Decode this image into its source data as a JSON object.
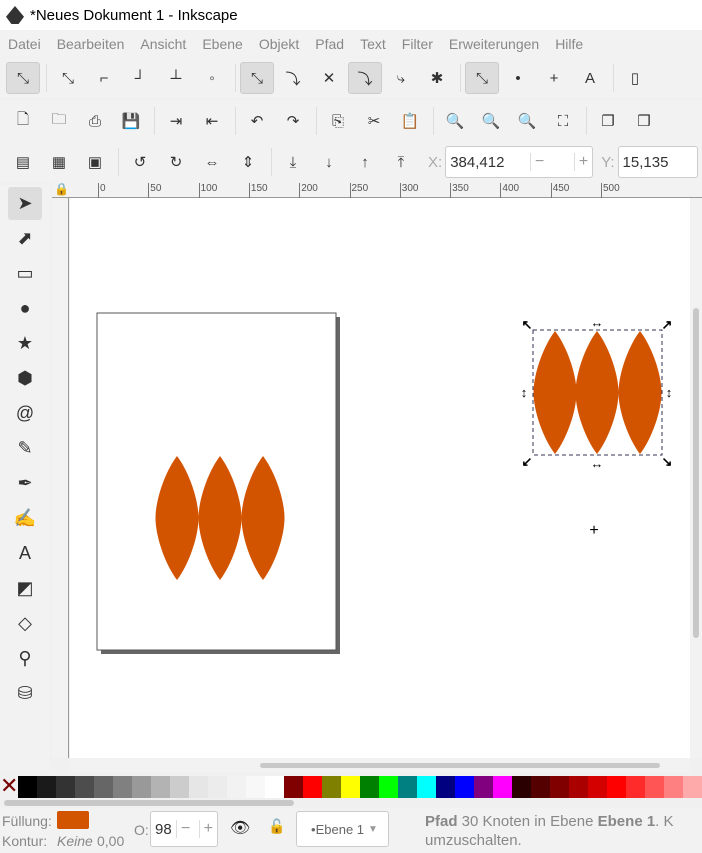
{
  "window": {
    "title": "*Neues Dokument 1 - Inkscape"
  },
  "menu": [
    "Datei",
    "Bearbeiten",
    "Ansicht",
    "Ebene",
    "Objekt",
    "Pfad",
    "Text",
    "Filter",
    "Erweiterungen",
    "Hilfe"
  ],
  "toolbar_snap": [
    {
      "icon": "snap-enable-icon",
      "g": "⤡",
      "on": true
    },
    {
      "icon": "snap-bbox-icon",
      "g": "⤡"
    },
    {
      "icon": "snap-bbox-edge-icon",
      "g": "⌐"
    },
    {
      "icon": "snap-bbox-corner-icon",
      "g": "┘"
    },
    {
      "icon": "snap-bbox-midpoint-icon",
      "g": "┴"
    },
    {
      "icon": "snap-bbox-center-icon",
      "g": "◦"
    },
    {
      "icon": "snap-nodes-icon",
      "g": "⤡",
      "on": true
    },
    {
      "icon": "snap-path-icon",
      "g": "⤵"
    },
    {
      "icon": "snap-intersection-icon",
      "g": "✕"
    },
    {
      "icon": "snap-cusp-icon",
      "g": "⤵",
      "on": true
    },
    {
      "icon": "snap-smooth-icon",
      "g": "⤷"
    },
    {
      "icon": "snap-midpoint-icon",
      "g": "✱"
    },
    {
      "icon": "snap-others-icon",
      "g": "⤡",
      "on": true
    },
    {
      "icon": "snap-center-icon",
      "g": "•"
    },
    {
      "icon": "snap-rotation-center-icon",
      "g": "+"
    },
    {
      "icon": "snap-text-baseline-icon",
      "g": "A"
    },
    {
      "icon": "snap-page-icon",
      "g": "▯"
    }
  ],
  "toolbar_commands": [
    {
      "icon": "new-document-icon",
      "g": "🗋"
    },
    {
      "icon": "open-icon",
      "g": "🗀"
    },
    {
      "icon": "print-icon",
      "g": "⎙"
    },
    {
      "icon": "save-icon",
      "g": "💾"
    },
    {
      "icon": "import-icon",
      "g": "⇥"
    },
    {
      "icon": "export-icon",
      "g": "⇤"
    },
    {
      "icon": "undo-icon",
      "g": "↶"
    },
    {
      "icon": "redo-icon",
      "g": "↷"
    },
    {
      "icon": "copy-icon",
      "g": "⎘"
    },
    {
      "icon": "cut-icon",
      "g": "✂"
    },
    {
      "icon": "paste-icon",
      "g": "📋"
    },
    {
      "icon": "zoom-selection-icon",
      "g": "🔍"
    },
    {
      "icon": "zoom-drawing-icon",
      "g": "🔍"
    },
    {
      "icon": "zoom-page-icon",
      "g": "🔍"
    },
    {
      "icon": "zoom-fit-width-icon",
      "g": "⛶"
    },
    {
      "icon": "duplicate-icon",
      "g": "❐"
    },
    {
      "icon": "clone-icon",
      "g": "❒"
    }
  ],
  "toolbar_select": [
    {
      "icon": "select-all-icon",
      "g": "▤"
    },
    {
      "icon": "select-all-layers-icon",
      "g": "▦"
    },
    {
      "icon": "deselect-icon",
      "g": "▣"
    },
    {
      "icon": "rotate-ccw-icon",
      "g": "↺"
    },
    {
      "icon": "rotate-cw-icon",
      "g": "↻"
    },
    {
      "icon": "flip-horizontal-icon",
      "g": "⇔"
    },
    {
      "icon": "flip-vertical-icon",
      "g": "⇕"
    },
    {
      "icon": "lower-to-bottom-icon",
      "g": "⤓"
    },
    {
      "icon": "lower-icon",
      "g": "↓"
    },
    {
      "icon": "raise-icon",
      "g": "↑"
    },
    {
      "icon": "raise-to-top-icon",
      "g": "⤒"
    }
  ],
  "coords": {
    "x_label": "X:",
    "x_value": "384,412",
    "y_label": "Y:",
    "y_value": "15,135",
    "minus": "−",
    "plus": "+"
  },
  "ruler_ticks": [
    "0",
    "50",
    "100",
    "150",
    "200",
    "250",
    "300",
    "350",
    "400",
    "450",
    "500"
  ],
  "tools": [
    {
      "icon": "selector-tool-icon",
      "g": "➤",
      "on": true
    },
    {
      "icon": "node-tool-icon",
      "g": "⬈"
    },
    {
      "icon": "rectangle-tool-icon",
      "g": "▭"
    },
    {
      "icon": "ellipse-tool-icon",
      "g": "●"
    },
    {
      "icon": "star-tool-icon",
      "g": "★"
    },
    {
      "icon": "3d-box-tool-icon",
      "g": "⬢"
    },
    {
      "icon": "spiral-tool-icon",
      "g": "@"
    },
    {
      "icon": "pencil-tool-icon",
      "g": "✎"
    },
    {
      "icon": "pen-tool-icon",
      "g": "✒"
    },
    {
      "icon": "calligraphy-tool-icon",
      "g": "✍"
    },
    {
      "icon": "text-tool-icon",
      "g": "A"
    },
    {
      "icon": "gradient-tool-icon",
      "g": "◩"
    },
    {
      "icon": "mesh-tool-icon",
      "g": "◇"
    },
    {
      "icon": "dropper-tool-icon",
      "g": "⚲"
    },
    {
      "icon": "paint-bucket-tool-icon",
      "g": "⛁"
    }
  ],
  "colors": {
    "fill": "#d35400",
    "selection": "#000000"
  },
  "palette": [
    "#000000",
    "#1a1a1a",
    "#333333",
    "#4d4d4d",
    "#666666",
    "#808080",
    "#999999",
    "#b3b3b3",
    "#cccccc",
    "#e6e6e6",
    "#ececec",
    "#f2f2f2",
    "#f8f8f8",
    "#ffffff",
    "#800000",
    "#ff0000",
    "#808000",
    "#ffff00",
    "#008000",
    "#00ff00",
    "#008080",
    "#00ffff",
    "#000080",
    "#0000ff",
    "#800080",
    "#ff00ff",
    "#2b0000",
    "#550000",
    "#800000",
    "#aa0000",
    "#d40000",
    "#ff0000",
    "#ff2a2a",
    "#ff5555",
    "#ff8080",
    "#ffaaaa"
  ],
  "status": {
    "fill_label": "Füllung:",
    "stroke_label": "Kontur:",
    "stroke_value": "Keine",
    "stroke_width": "0,00",
    "opacity_label": "O:",
    "opacity_value": "98",
    "layer": "•Ebene 1",
    "msg_bold1": "Pfad",
    "msg1": " 30 Knoten in Ebene ",
    "msg_bold2": "Ebene 1",
    "msg2": ". K",
    "msg_line2": "umzuschalten."
  }
}
